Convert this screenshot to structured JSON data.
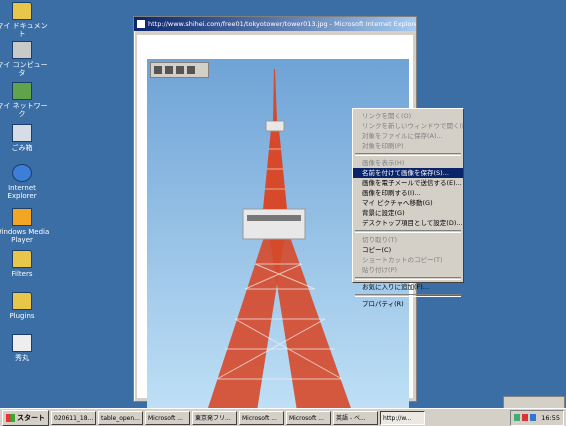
{
  "desktop": {
    "icons": [
      {
        "label": "マイ ドキュメント",
        "icon": "folder-icon"
      },
      {
        "label": "マイ コンピュータ",
        "icon": "computer-icon"
      },
      {
        "label": "マイ ネットワーク",
        "icon": "network-icon"
      },
      {
        "label": "ごみ箱",
        "icon": "recycle-bin-icon"
      },
      {
        "label": "Internet Explorer",
        "icon": "ie-icon"
      },
      {
        "label": "Windows Media Player",
        "icon": "media-player-icon"
      },
      {
        "label": "Filters",
        "icon": "folder-icon"
      },
      {
        "label": "Plugins",
        "icon": "folder-icon"
      },
      {
        "label": "秀丸",
        "icon": "hidemaru-icon"
      }
    ]
  },
  "window": {
    "title": "http://www.shihei.com/free01/tokyotower/tower013.jpg - Microsoft Internet Explorer",
    "controls": {
      "minimize": "_",
      "maximize": "□",
      "close": "×"
    }
  },
  "context_menu": {
    "items": [
      {
        "label": "リンクを開く(O)",
        "disabled": true
      },
      {
        "label": "リンクを新しいウィンドウで開く(N)",
        "disabled": true
      },
      {
        "label": "対象をファイルに保存(A)...",
        "disabled": true
      },
      {
        "label": "対象を印刷(P)",
        "disabled": true
      },
      {
        "sep": true
      },
      {
        "label": "画像を表示(H)",
        "disabled": true
      },
      {
        "label": "名前を付けて画像を保存(S)...",
        "selected": true
      },
      {
        "label": "画像を電子メールで送信する(E)..."
      },
      {
        "label": "画像を印刷する(I)..."
      },
      {
        "label": "マイ ピクチャへ移動(G)"
      },
      {
        "label": "背景に設定(G)"
      },
      {
        "label": "デスクトップ項目として設定(D)..."
      },
      {
        "sep": true
      },
      {
        "label": "切り取り(T)",
        "disabled": true
      },
      {
        "label": "コピー(C)"
      },
      {
        "label": "ショートカットのコピー(T)",
        "disabled": true
      },
      {
        "label": "貼り付け(P)",
        "disabled": true
      },
      {
        "sep": true
      },
      {
        "label": "お気に入りに追加(F)..."
      },
      {
        "sep": true
      },
      {
        "label": "プロパティ(R)"
      }
    ]
  },
  "taskbar": {
    "start": "スタート",
    "tasks": [
      "020611_18...",
      "table_open...",
      "Microsoft ...",
      "東京発フリ...",
      "Microsoft ...",
      "Microsoft ...",
      "英語 - ベ...",
      "http://w..."
    ],
    "active_task": 7,
    "clock": "16:55"
  }
}
